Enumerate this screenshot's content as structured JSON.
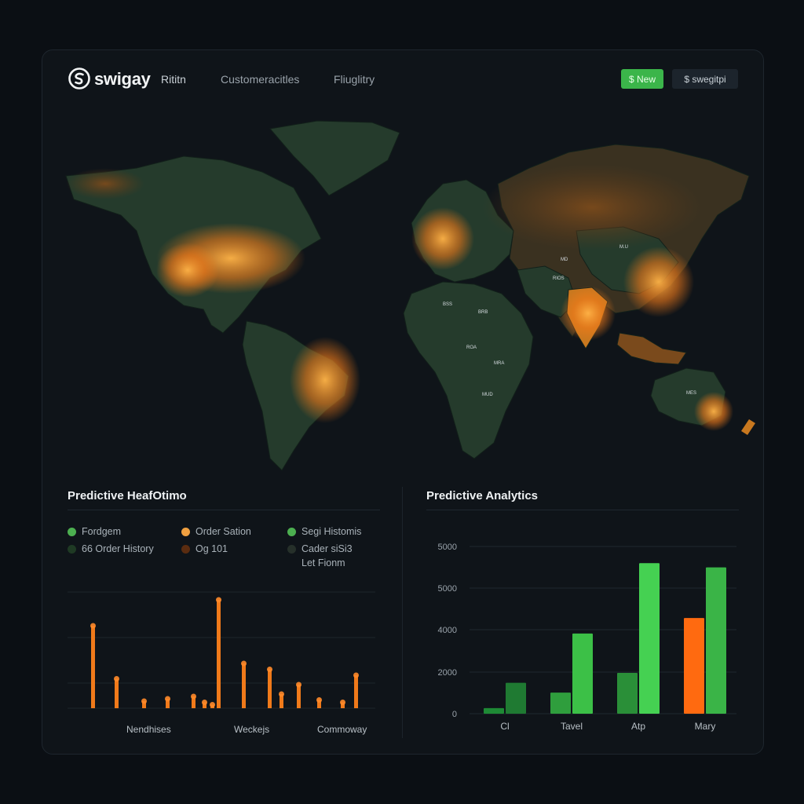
{
  "header": {
    "brand": "swigay",
    "nav": [
      "Rititn",
      "Customeracitles",
      "Fliuglitry"
    ],
    "new_button": "$ New",
    "user_button": "$ swegitpi"
  },
  "colors": {
    "accent_green": "#3bb54a",
    "accent_orange": "#f07a1a",
    "land_green": "#253b2c",
    "land_brown": "#5b3a1a",
    "background": "#0f1419"
  },
  "map": {
    "country_labels": [
      "M.U",
      "MD",
      "BSS",
      "BRB",
      "ROA",
      "MRA",
      "RIOS",
      "MUD",
      "MES"
    ]
  },
  "heatmap_panel": {
    "title": "Predictive HeafOtimo",
    "legend": [
      {
        "label": "Fordgem",
        "color": "#4caf50"
      },
      {
        "label": "Order Sation",
        "color": "#f0a040"
      },
      {
        "label": "Segi Histomis",
        "color": "#4caf50"
      },
      {
        "label": "66 Order History",
        "color": "#1f3a24"
      },
      {
        "label": "Og 101",
        "color": "#5a2c10"
      },
      {
        "label": "Cader siSi3",
        "color": "#26302a",
        "sub": "Let Fionm"
      }
    ],
    "x_labels": [
      "Nendhises",
      "Weckejs",
      "Commoway"
    ]
  },
  "chart_data": {
    "type": "bar",
    "title": "Predictive Analytics",
    "categories": [
      "Cl",
      "Tavel",
      "Atp",
      "Mary"
    ],
    "series": [
      {
        "values": [
          200,
          750,
          1450,
          3400
        ]
      },
      {
        "values": [
          1100,
          2850,
          5350,
          5200
        ]
      }
    ],
    "ytick_labels": [
      "0",
      "2000",
      "4000",
      "5000",
      "5000"
    ],
    "ylim": [
      0,
      6000
    ],
    "grid": true,
    "bar_colors": [
      [
        "#1e8a35",
        "#1f7a32"
      ],
      [
        "#2f9e3d",
        "#3cc047"
      ],
      [
        "#2a8f38",
        "#45d152"
      ],
      [
        "#ff6a10",
        "#3ab447"
      ]
    ]
  },
  "heat_chart_data": {
    "type": "bar",
    "values": [
      0.7,
      0.25,
      0.06,
      0.08,
      0.1,
      0.05,
      0.03,
      0.92,
      0.38,
      0.33,
      0.12,
      0.2,
      0.07,
      0.05,
      0.28
    ]
  }
}
